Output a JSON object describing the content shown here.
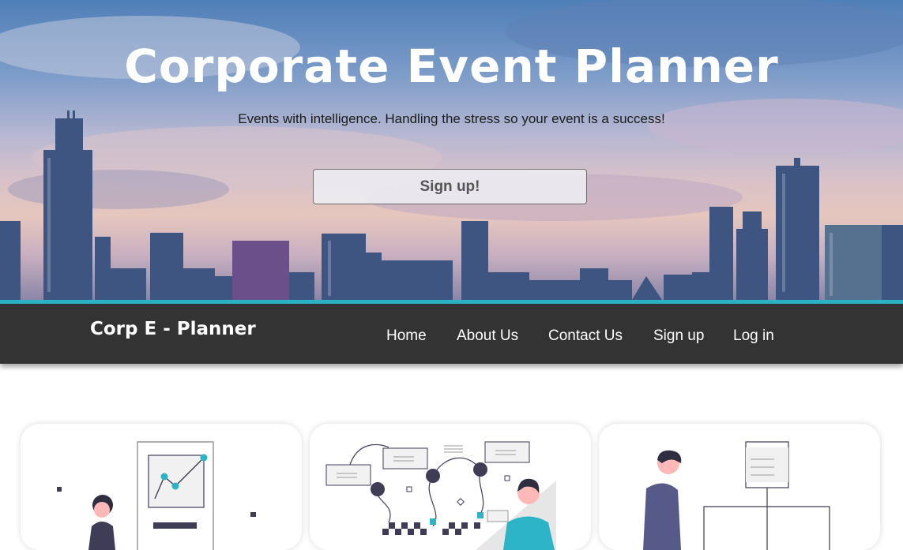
{
  "hero": {
    "title": "Corporate Event Planner",
    "subtitle": "Events with intelligence. Handling the stress so your event is a success!",
    "cta_label": "Sign up!"
  },
  "navbar": {
    "brand": "Corp E - Planner",
    "links": [
      "Home",
      "About Us",
      "Contact Us",
      "Sign up",
      "Log in"
    ]
  },
  "colors": {
    "accent": "#2cb3c6",
    "navbar_bg": "#333333",
    "illustration_dark": "#3f3d56",
    "illustration_accent": "#2cb3c6"
  },
  "cards": [
    {
      "illustration": "person-with-growth-chart-illustration"
    },
    {
      "illustration": "person-with-flow-diagram-illustration"
    },
    {
      "illustration": "person-with-org-chart-illustration"
    }
  ]
}
